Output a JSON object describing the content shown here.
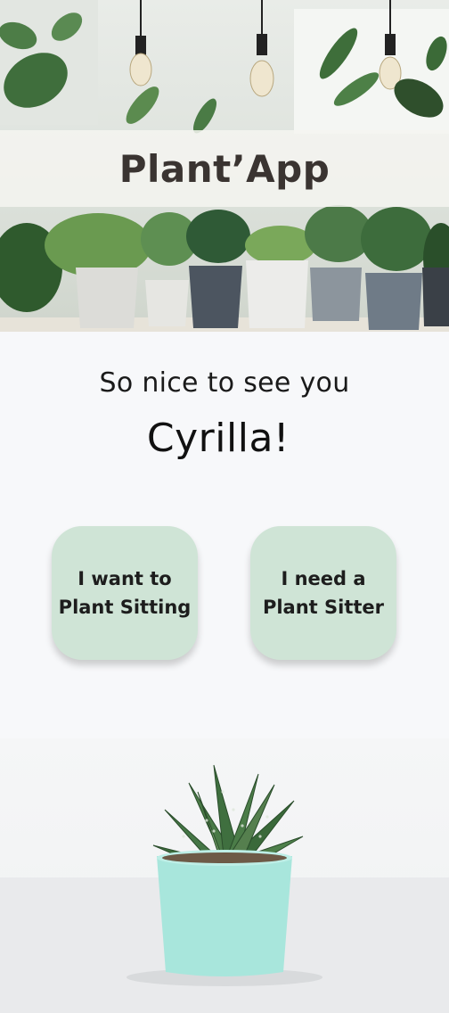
{
  "header": {
    "app_title": "Plant’App"
  },
  "greeting": {
    "line": "So nice to see you",
    "name": "Cyrilla!"
  },
  "actions": [
    {
      "line1": "I want to",
      "line2": "Plant Sitting"
    },
    {
      "line1": "I need a",
      "line2": "Plant Sitter"
    }
  ],
  "colors": {
    "button_bg": "#cfe4d6",
    "title_text": "#3a3431",
    "pot_mint": "#a8e6dc"
  },
  "images": {
    "hero": "houseplants-shelf-photo",
    "bottom": "succulent-in-mint-pot-photo"
  }
}
